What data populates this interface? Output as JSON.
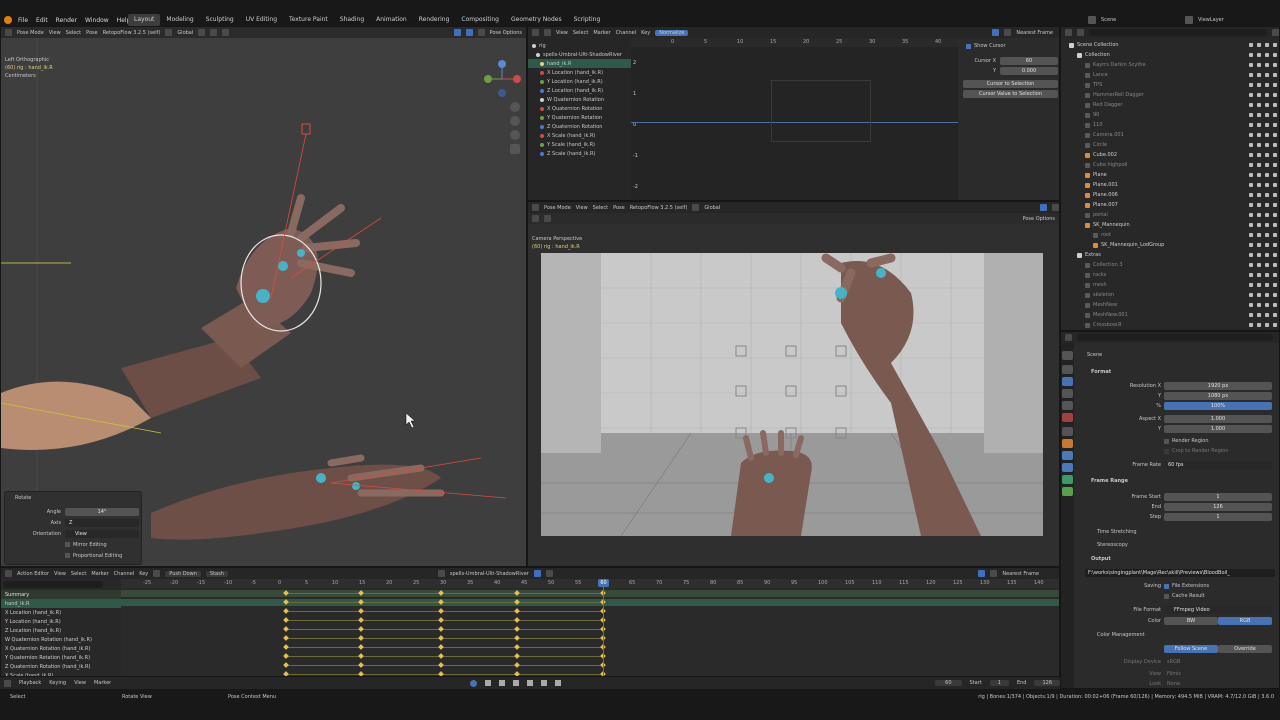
{
  "topbar": {
    "menus": [
      "File",
      "Edit",
      "Render",
      "Window",
      "Help"
    ],
    "workspaces": [
      "Layout",
      "Modeling",
      "Sculpting",
      "UV Editing",
      "Texture Paint",
      "Shading",
      "Animation",
      "Rendering",
      "Compositing",
      "Geometry Nodes",
      "Scripting"
    ],
    "active_workspace": "Layout",
    "scene_label": "Scene",
    "viewlayer_label": "ViewLayer"
  },
  "viewport_left": {
    "mode": "Pose Mode",
    "menus": [
      "View",
      "Select",
      "Pose"
    ],
    "addon": "RetopoFlow 3.2.5 (self)",
    "transform": "Global",
    "pose_options": "Pose Options",
    "overlay_title": "Left Orthographic",
    "overlay_sub": "(60) rig : hand_ik.R",
    "overlay_units": "Centimeters",
    "rotate_panel": {
      "title": "Rotate",
      "angle_label": "Angle",
      "angle_value": "14°",
      "axis_label": "Axis",
      "axis_value": "Z",
      "orientation_label": "Orientation",
      "orientation_value": "View",
      "mirror": "Mirror Editing",
      "proportional": "Proportional Editing"
    }
  },
  "graph_editor": {
    "menus": [
      "View",
      "Select",
      "Marker",
      "Channel",
      "Key"
    ],
    "normalize": "Normalize",
    "interp": "Nearest Frame",
    "ruler": [
      "0",
      "5",
      "10",
      "15",
      "20",
      "25",
      "30",
      "35",
      "40"
    ],
    "yvals": [
      "2",
      "1",
      "0",
      "-1",
      "-2"
    ],
    "channels": [
      "rig",
      "spells-Umbral-Ulti-ShadowRiver",
      "hand_ik.R",
      "X Location (hand_ik.R)",
      "Y Location (hand_ik.R)",
      "Z Location (hand_ik.R)",
      "W Quaternion Rotation",
      "X Quaternion Rotation",
      "Y Quaternion Rotation",
      "Z Quaternion Rotation",
      "X Scale (hand_ik.R)",
      "Y Scale (hand_ik.R)",
      "Z Scale (hand_ik.R)"
    ],
    "cursor_panel": {
      "show_cursor": "Show Cursor",
      "cursor_x_label": "Cursor X",
      "cursor_x": "60",
      "y_label": "Y",
      "y_value": "0.000",
      "btn1": "Cursor to Selection",
      "btn2": "Cursor Value to Selection"
    }
  },
  "camera_view": {
    "mode": "Pose Mode",
    "menus": [
      "View",
      "Select",
      "Pose"
    ],
    "addon": "RetopoFlow 3.2.5 (self)",
    "transform": "Global",
    "pose_options": "Pose Options",
    "overlay_title": "Camera Perspective",
    "overlay_sub": "(60) rig : hand_ik.R"
  },
  "outliner": {
    "items": [
      {
        "name": "Scene Collection",
        "indent": 0,
        "color": "#d0d0d0",
        "dim": false
      },
      {
        "name": "Collection",
        "indent": 1,
        "color": "#d0d0d0",
        "dim": false
      },
      {
        "name": "Kayrrs Darkin Scythe",
        "indent": 2,
        "color": "#888",
        "dim": true
      },
      {
        "name": "Lance",
        "indent": 2,
        "color": "#888",
        "dim": true
      },
      {
        "name": "TPS",
        "indent": 2,
        "color": "#888",
        "dim": true
      },
      {
        "name": "HammerRell Dagger",
        "indent": 2,
        "color": "#888",
        "dim": true
      },
      {
        "name": "Red Dagger",
        "indent": 2,
        "color": "#888",
        "dim": true
      },
      {
        "name": "90",
        "indent": 2,
        "color": "#888",
        "dim": true
      },
      {
        "name": "110",
        "indent": 2,
        "color": "#888",
        "dim": true
      },
      {
        "name": "Camera.001",
        "indent": 2,
        "color": "#888",
        "dim": true
      },
      {
        "name": "Circle",
        "indent": 2,
        "color": "#888",
        "dim": true
      },
      {
        "name": "Cube.002",
        "indent": 2,
        "color": "#d0d0d0",
        "dim": false
      },
      {
        "name": "Cube.highpoll",
        "indent": 2,
        "color": "#888",
        "dim": true
      },
      {
        "name": "Plane",
        "indent": 2,
        "color": "#d0d0d0",
        "dim": false
      },
      {
        "name": "Plane.001",
        "indent": 2,
        "color": "#d0d0d0",
        "dim": false
      },
      {
        "name": "Plane.006",
        "indent": 2,
        "color": "#d0d0d0",
        "dim": false
      },
      {
        "name": "Plane.007",
        "indent": 2,
        "color": "#d0d0d0",
        "dim": false
      },
      {
        "name": "portal",
        "indent": 2,
        "color": "#888",
        "dim": true
      },
      {
        "name": "SK_Mannequin",
        "indent": 2,
        "color": "#d0d0d0",
        "dim": false
      },
      {
        "name": "root",
        "indent": 3,
        "color": "#888",
        "dim": true
      },
      {
        "name": "SK_Mannequin_LodGroup",
        "indent": 3,
        "color": "#d0d0d0",
        "dim": false
      },
      {
        "name": "Extras",
        "indent": 1,
        "color": "#d0d0d0",
        "dim": false
      },
      {
        "name": "Collection 3",
        "indent": 2,
        "color": "#888",
        "dim": true
      },
      {
        "name": "racks",
        "indent": 2,
        "color": "#888",
        "dim": true
      },
      {
        "name": "mesh",
        "indent": 2,
        "color": "#888",
        "dim": true
      },
      {
        "name": "skeleton",
        "indent": 2,
        "color": "#888",
        "dim": true
      },
      {
        "name": "MeshNew",
        "indent": 2,
        "color": "#888",
        "dim": true
      },
      {
        "name": "MeshNew.001",
        "indent": 2,
        "color": "#888",
        "dim": true
      },
      {
        "name": "Crossbow.R",
        "indent": 2,
        "color": "#888",
        "dim": true
      }
    ]
  },
  "properties": {
    "context": "Scene",
    "format_title": "Format",
    "res_x_label": "Resolution X",
    "res_x": "1920 px",
    "res_y_label": "Y",
    "res_y": "1080 px",
    "res_pct_label": "%",
    "res_pct": "100%",
    "aspect_x_label": "Aspect X",
    "aspect_x": "1.000",
    "aspect_y_label": "Y",
    "aspect_y": "1.000",
    "render_region": "Render Region",
    "crop": "Crop to Render Region",
    "fps_label": "Frame Rate",
    "fps": "60 fps",
    "frame_range_title": "Frame Range",
    "fstart_label": "Frame Start",
    "fstart": "1",
    "fend_label": "End",
    "fend": "126",
    "fstep_label": "Step",
    "fstep": "1",
    "time_stretching": "Time Stretching",
    "stereoscopy": "Stereoscopy",
    "output_title": "Output",
    "output_path": "F:\\works\\singingplant\\Mage\\Rec\\skill\\Previews\\BloodBoil_",
    "saving_label": "Saving",
    "file_ext": "File Extensions",
    "cache_result": "Cache Result",
    "file_format_label": "File Format",
    "file_format": "FFmpeg Video",
    "color_label": "Color",
    "bw": "BW",
    "rgb": "RGB",
    "cm_title": "Color Management",
    "follow_scene": "Follow Scene",
    "override": "Override",
    "display_device_label": "Display Device",
    "display_device": "sRGB",
    "view_label": "View",
    "view_value": "Filmic",
    "look_label": "Look",
    "look_value": "None"
  },
  "action_editor": {
    "mode": "Action Editor",
    "menus": [
      "View",
      "Select",
      "Marker",
      "Channel",
      "Key"
    ],
    "push_down": "Push Down",
    "stash": "Stash",
    "action_name": "spells-Umbral-Ulti-ShadowRiver",
    "interp": "Nearest Frame",
    "ruler": [
      "-25",
      "-20",
      "-15",
      "-10",
      "-5",
      "0",
      "5",
      "10",
      "15",
      "20",
      "25",
      "30",
      "35",
      "40",
      "45",
      "50",
      "55",
      "60",
      "65",
      "70",
      "75",
      "80",
      "85",
      "90",
      "95",
      "100",
      "105",
      "110",
      "115",
      "120",
      "125",
      "130",
      "135",
      "140"
    ],
    "current_frame": "60",
    "channels": [
      "Summary",
      "hand_ik.R",
      "X Location (hand_ik.R)",
      "Y Location (hand_ik.R)",
      "Z Location (hand_ik.R)",
      "W Quaternion Rotation (hand_ik.R)",
      "X Quaternion Rotation (hand_ik.R)",
      "Y Quaternion Rotation (hand_ik.R)",
      "Z Quaternion Rotation (hand_ik.R)",
      "X Scale (hand_ik.R)"
    ]
  },
  "timeline": {
    "menus": [
      "Playback",
      "Keying",
      "View",
      "Marker"
    ],
    "frame": "60",
    "start_label": "Start",
    "start": "1",
    "end_label": "End",
    "end": "126"
  },
  "statusbar": {
    "select": "Select",
    "rotate_view": "Rotate View",
    "context_menu": "Pose Context Menu",
    "stats": "rig | Bones:1/374 | Objects:1/9 | Duration: 00:02+06 (Frame 60/126) | Memory: 494.5 MiB | VRAM: 4.7/12.0 GiB | 3.6.0"
  }
}
